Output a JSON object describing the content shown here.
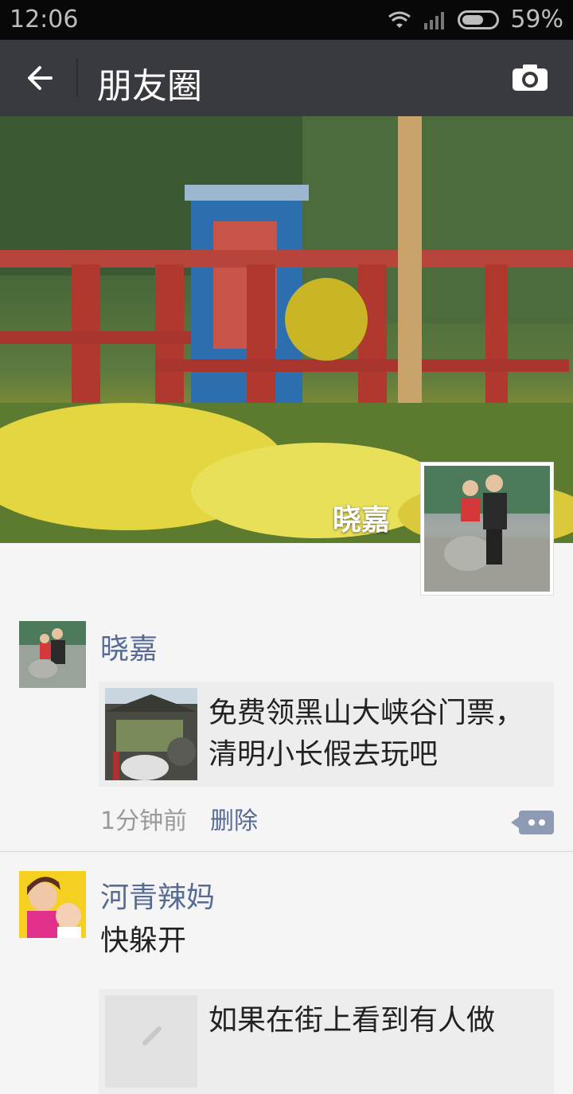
{
  "status_bar": {
    "time": "12:06",
    "battery": "59%"
  },
  "header": {
    "title": "朋友圈",
    "back_icon": "arrow-left-icon",
    "camera_icon": "camera-icon"
  },
  "cover": {
    "name": "晓嘉"
  },
  "posts": [
    {
      "name": "晓嘉",
      "link": {
        "title": "免费领黑山大峡谷门票，清明小长假去玩吧"
      },
      "time": "1分钟前",
      "delete_label": "删除"
    },
    {
      "name": "河青辣妈",
      "text": "快躲开",
      "link": {
        "title": "如果在街上看到有人做"
      }
    }
  ]
}
